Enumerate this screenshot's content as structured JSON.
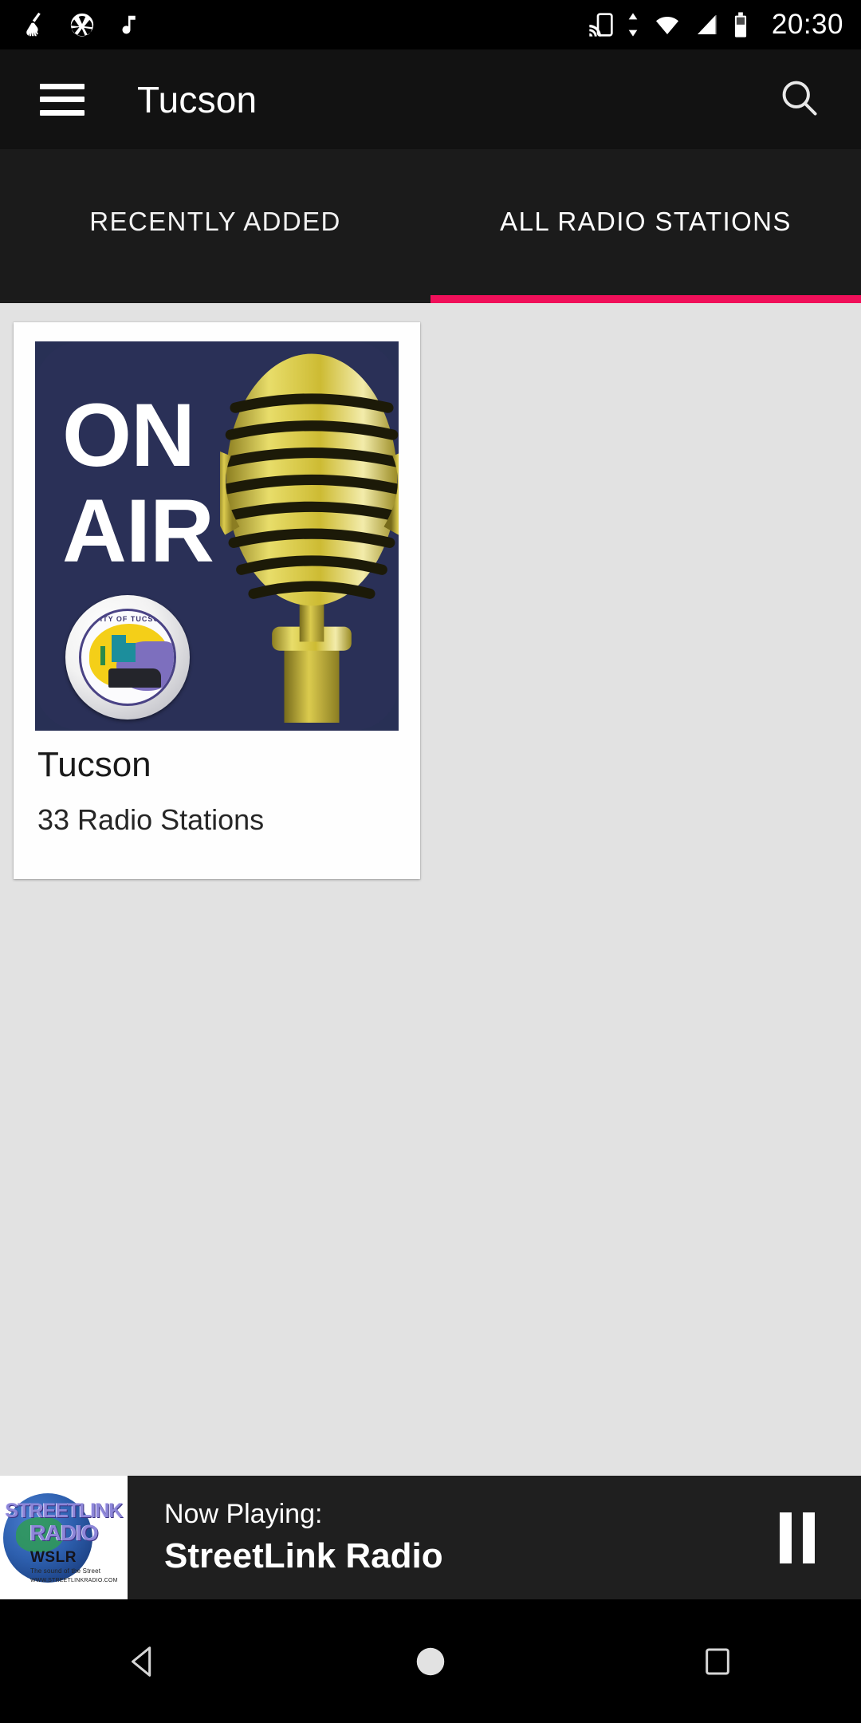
{
  "status_bar": {
    "time": "20:30",
    "left_icons": [
      "broom-icon",
      "aperture-icon",
      "music-note-icon"
    ],
    "right_icons": [
      "cast-icon",
      "sync-arrows-icon",
      "wifi-icon",
      "cellular-signal-icon",
      "battery-icon"
    ]
  },
  "app_bar": {
    "title": "Tucson",
    "menu_icon": "hamburger-menu-icon",
    "search_icon": "search-icon"
  },
  "tabs": {
    "active_index": 1,
    "accent_color": "#f0105a",
    "items": [
      {
        "label": "RECENTLY ADDED"
      },
      {
        "label": "ALL RADIO STATIONS"
      }
    ]
  },
  "content": {
    "background_color": "#e2e2e2",
    "cards": [
      {
        "title": "Tucson",
        "subtitle": "33 Radio Stations",
        "artwork": {
          "line1": "ON",
          "line2": "AIR",
          "seal_text": "CITY OF TUCSON",
          "background_color": "#2a3057",
          "mic_color": "#d4c33c"
        }
      }
    ]
  },
  "now_playing": {
    "label": "Now Playing:",
    "title": "StreetLink Radio",
    "pause_icon": "pause-icon",
    "thumbnail": {
      "logo_line1": "STREETLINK",
      "logo_line2": "RADIO",
      "callsign": "WSLR",
      "tagline": "The sound of the Street",
      "url": "WWW.STREETLINKRADIO.COM"
    }
  },
  "nav_bar": {
    "back_icon": "back-triangle-icon",
    "home_icon": "home-circle-icon",
    "recents_icon": "recents-square-icon"
  }
}
